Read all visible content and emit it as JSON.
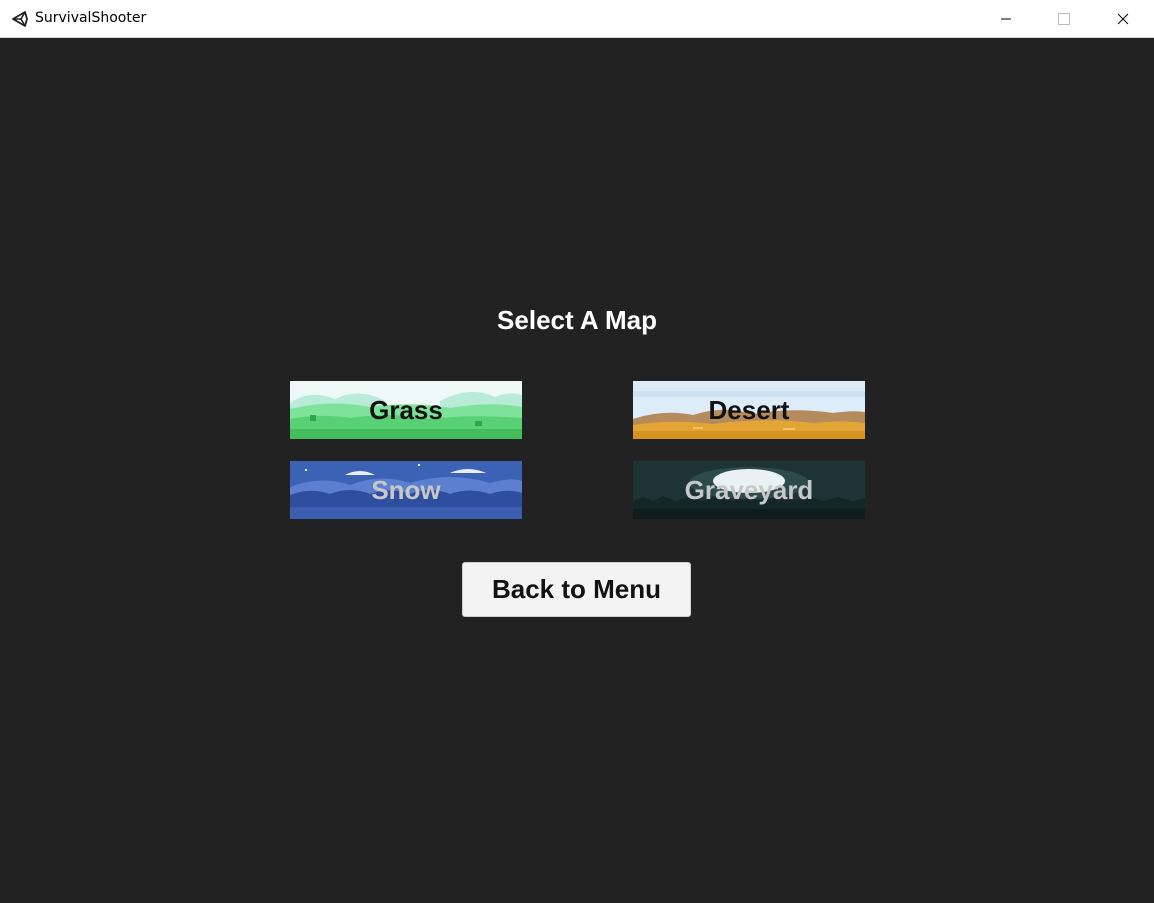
{
  "window": {
    "title": "SurvivalShooter",
    "minimize_icon": "minimize-icon",
    "maximize_icon": "maximize-icon",
    "close_icon": "close-icon"
  },
  "screen": {
    "heading": "Select A Map",
    "maps": [
      {
        "label": "Grass",
        "enabled": true,
        "theme": "grass"
      },
      {
        "label": "Desert",
        "enabled": true,
        "theme": "desert"
      },
      {
        "label": "Snow",
        "enabled": false,
        "theme": "snow"
      },
      {
        "label": "Graveyard",
        "enabled": false,
        "theme": "graveyard"
      }
    ],
    "back_button": "Back to Menu"
  },
  "colors": {
    "background": "#222222",
    "titlebar": "#ffffff",
    "button": "#f3f3f3"
  }
}
